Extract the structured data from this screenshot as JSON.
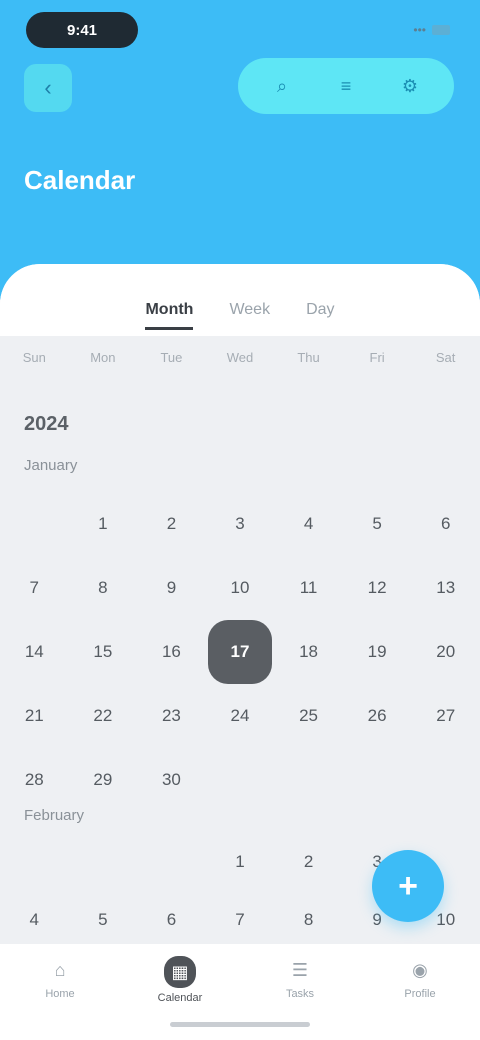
{
  "status_bar": {
    "time": "9:41",
    "signal": "•••"
  },
  "header": {
    "back_icon": "chevron-left-icon",
    "title": "Calendar",
    "actions": [
      {
        "icon": "search-icon",
        "glyph": "⌕"
      },
      {
        "icon": "filter-icon",
        "glyph": "≡"
      },
      {
        "icon": "settings-icon",
        "glyph": "⚙"
      }
    ]
  },
  "tabs": [
    {
      "label": "Month",
      "active": true
    },
    {
      "label": "Week",
      "active": false
    },
    {
      "label": "Day",
      "active": false
    }
  ],
  "weekdays": [
    "Sun",
    "Mon",
    "Tue",
    "Wed",
    "Thu",
    "Fri",
    "Sat"
  ],
  "calendar": {
    "year": "2024",
    "month_1": "January",
    "days_1": [
      [
        "",
        "1",
        "2",
        "3",
        "4",
        "5",
        "6"
      ],
      [
        "7",
        "8",
        "9",
        "10",
        "11",
        "12",
        "13"
      ],
      [
        "14",
        "15",
        "16",
        "17",
        "18",
        "19",
        "20"
      ],
      [
        "21",
        "22",
        "23",
        "24",
        "25",
        "26",
        "27"
      ],
      [
        "28",
        "29",
        "30",
        "",
        "",
        "",
        ""
      ]
    ],
    "selected_day": "17",
    "month_2": "February",
    "days_2": [
      [
        "",
        "",
        "",
        "1",
        "2",
        "3",
        ""
      ],
      [
        "4",
        "5",
        "6",
        "7",
        "8",
        "9",
        "10"
      ]
    ]
  },
  "fab": {
    "icon": "plus-icon",
    "glyph": "+"
  },
  "bottom_nav": [
    {
      "label": "Home",
      "icon": "home-icon",
      "glyph": "⌂",
      "active": false
    },
    {
      "label": "Calendar",
      "icon": "calendar-icon",
      "glyph": "▦",
      "active": true
    },
    {
      "label": "Tasks",
      "icon": "tasks-icon",
      "glyph": "☰",
      "active": false
    },
    {
      "label": "Profile",
      "icon": "profile-icon",
      "glyph": "◉",
      "active": false
    }
  ],
  "colors": {
    "accent": "#3dbcf6",
    "selected": "#5a5e63",
    "background": "#eef0f3"
  }
}
